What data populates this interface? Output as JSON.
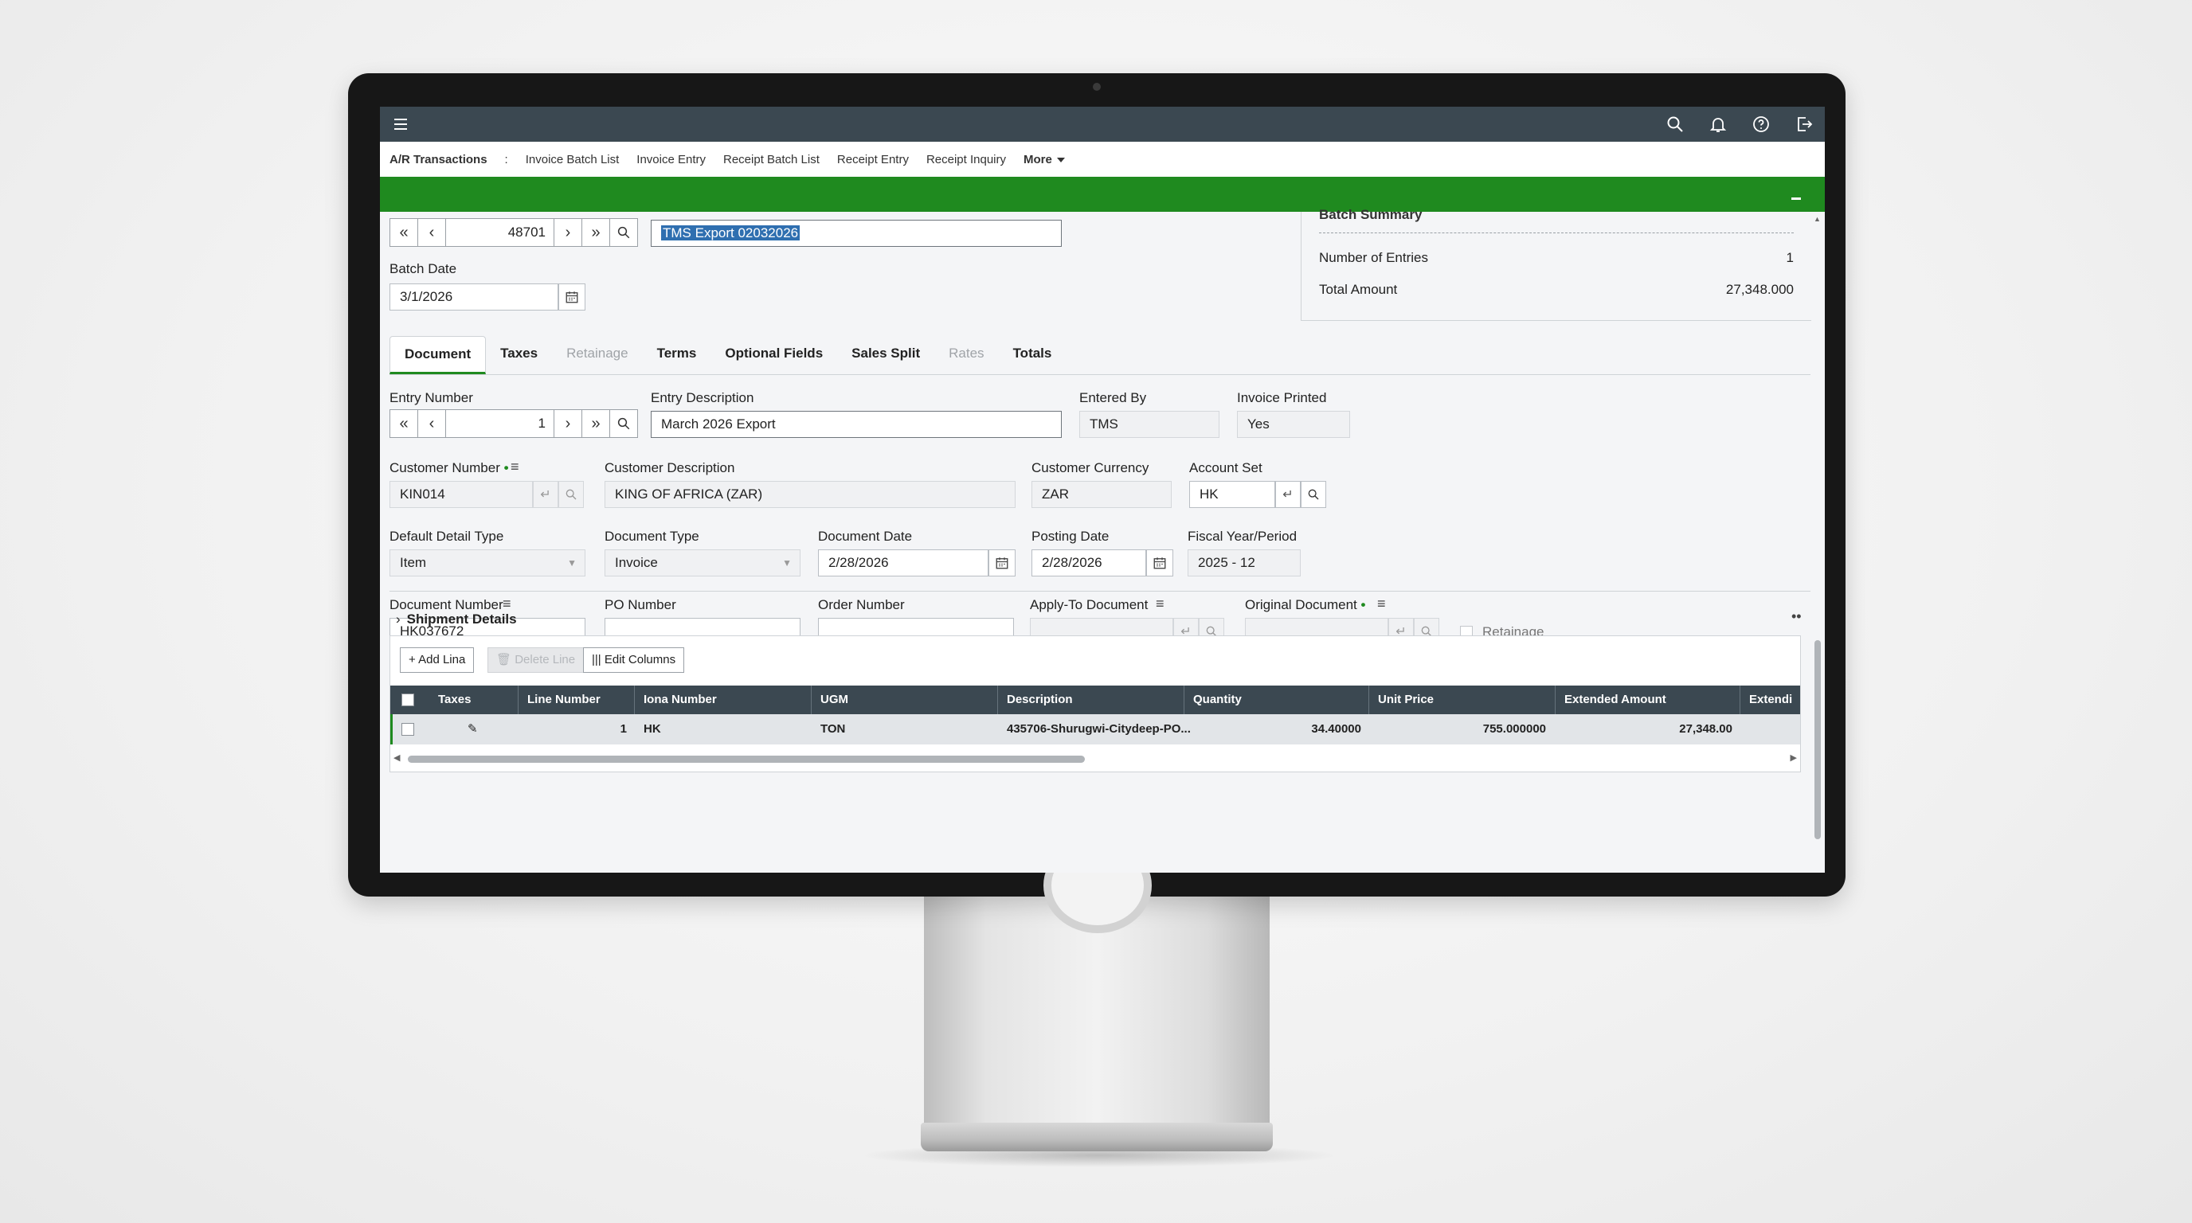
{
  "topbar": {
    "icons": [
      "menu-icon",
      "search-icon",
      "bell-icon",
      "help-icon",
      "logout-icon"
    ]
  },
  "nav": {
    "title": "A/R Transactions",
    "separator": ":",
    "items": [
      "Invoice Batch List",
      "Invoice Entry",
      "Receipt Batch List",
      "Receipt Entry",
      "Receipt Inquiry"
    ],
    "more": "More"
  },
  "colors": {
    "accent_green": "#1f8a1f",
    "header_dark": "#3b4851"
  },
  "batch": {
    "number": "48701",
    "description": "TMS Export 02032026",
    "date_label": "Batch Date",
    "date": "3/1/2026"
  },
  "summary": {
    "title": "Batch Summary",
    "entries_label": "Number of Entries",
    "entries_value": "1",
    "total_label": "Total Amount",
    "total_value": "27,348.000"
  },
  "tabs": [
    "Document",
    "Taxes",
    "Retainage",
    "Terms",
    "Optional Fields",
    "Sales Split",
    "Rates",
    "Totals"
  ],
  "entry": {
    "number_label": "Entry Number",
    "number": "1",
    "description_label": "Entry Description",
    "description": "March 2026 Export",
    "entered_by_label": "Entered By",
    "entered_by": "TMS",
    "invoice_printed_label": "Invoice Printed",
    "invoice_printed": "Yes"
  },
  "customer": {
    "number_label": "Customer Number",
    "number": "KIN014",
    "description_label": "Customer Description",
    "description": "KING OF AFRICA (ZAR)",
    "currency_label": "Customer Currency",
    "currency": "ZAR",
    "account_set_label": "Account Set",
    "account_set": "HK"
  },
  "doc": {
    "detail_type_label": "Default Detail Type",
    "detail_type": "Item",
    "type_label": "Document Type",
    "type": "Invoice",
    "date_label": "Document Date",
    "date": "2/28/2026",
    "posting_label": "Posting Date",
    "posting": "2/28/2026",
    "fiscal_label": "Fiscal Year/Period",
    "fiscal": "2025 - 12",
    "number_label": "Document Number",
    "number": "HK037672",
    "po_label": "PO Number",
    "po": "",
    "order_label": "Order Number",
    "order": "",
    "apply_label": "Apply-To Document",
    "apply": "",
    "original_label": "Original Document",
    "original": "",
    "retainage_label": "Retainage"
  },
  "shipment": {
    "title": "Shipment Details",
    "add_line": "Add Lina",
    "delete_line": "Delete Line",
    "edit_columns": "Edit Columns",
    "columns": [
      "Taxes",
      "Line Number",
      "Iona Number",
      "UGM",
      "Description",
      "Quantity",
      "Unit Price",
      "Extended Amount",
      "Extendi"
    ],
    "rows": [
      {
        "line": "1",
        "item": "HK",
        "uom": "TON",
        "description": "435706-Shurugwi-Citydeep-PO...",
        "quantity": "34.40000",
        "unit_price": "755.000000",
        "extended": "27,348.00"
      }
    ]
  }
}
